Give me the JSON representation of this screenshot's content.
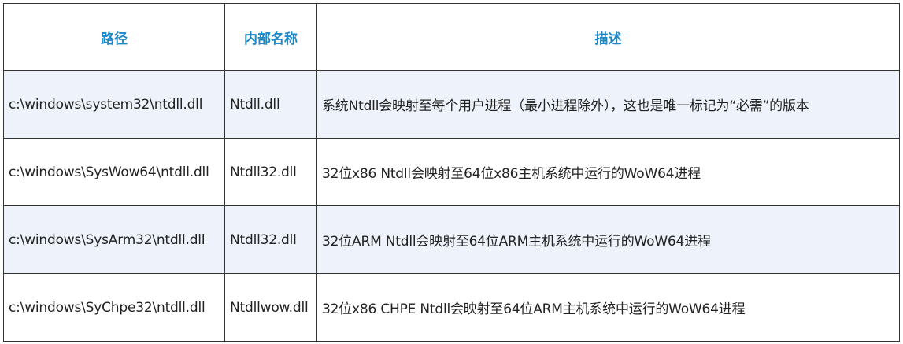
{
  "table": {
    "headers": [
      "路径",
      "内部名称",
      "描述"
    ],
    "rows": [
      {
        "path": "c:\\windows\\system32\\ntdll.dll",
        "internal_name": "Ntdll.dll",
        "description": "系统Ntdll会映射至每个用户进程（最小进程除外），这也是唯一标记为“必需”的版本"
      },
      {
        "path": "c:\\windows\\SysWow64\\ntdll.dll",
        "internal_name": "Ntdll32.dll",
        "description": "32位x86 Ntdll会映射至64位x86主机系统中运行的WoW64进程"
      },
      {
        "path": "c:\\windows\\SysArm32\\ntdll.dll",
        "internal_name": "Ntdll32.dll",
        "description": "32位ARM Ntdll会映射至64位ARM主机系统中运行的WoW64进程"
      },
      {
        "path": "c:\\windows\\SyChpe32\\ntdll.dll",
        "internal_name": "Ntdllwow.dll",
        "description": "32位x86 CHPE Ntdll会映射至64位ARM主机系统中运行的WoW64进程"
      }
    ]
  },
  "colors": {
    "header_text": "#1e88c7",
    "shaded_row": "#eef3fb",
    "border": "#333333"
  }
}
